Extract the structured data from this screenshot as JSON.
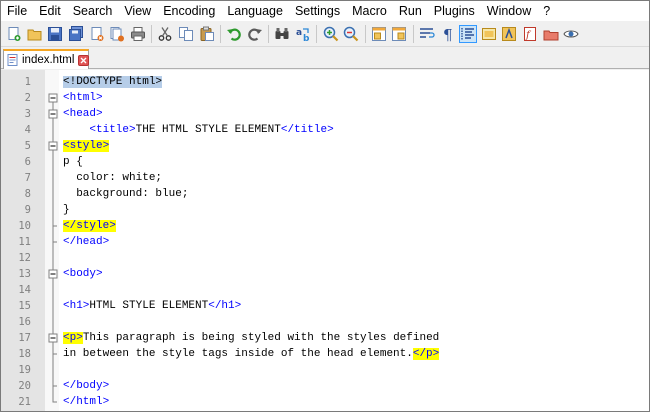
{
  "menu": [
    "File",
    "Edit",
    "Search",
    "View",
    "Encoding",
    "Language",
    "Settings",
    "Macro",
    "Run",
    "Plugins",
    "Window",
    "?"
  ],
  "toolbar": {
    "groups": [
      [
        "new-file-icon",
        "open-file-icon",
        "save-icon",
        "save-all-icon",
        "close-icon",
        "close-all-icon",
        "print-icon"
      ],
      [
        "cut-icon",
        "copy-icon",
        "paste-icon"
      ],
      [
        "undo-icon",
        "redo-icon"
      ],
      [
        "find-icon",
        "replace-icon"
      ],
      [
        "zoom-in-icon",
        "zoom-out-icon"
      ],
      [
        "sync-vertical-icon",
        "sync-horizontal-icon"
      ],
      [
        "word-wrap-icon",
        "show-all-chars-icon",
        "indent-guide-icon",
        "doc-map-icon",
        "function-list-icon",
        "folder-workspace-icon",
        "monitoring-icon"
      ]
    ],
    "active": "indent-guide-icon"
  },
  "tab": {
    "label": "index.html"
  },
  "lines": [
    {
      "n": "1",
      "segs": [
        [
          "doc",
          "<!DOCTYPE html>"
        ]
      ]
    },
    {
      "n": "2",
      "segs": [
        [
          "tag",
          "<html>"
        ]
      ]
    },
    {
      "n": "3",
      "segs": [
        [
          "tag",
          "<head>"
        ]
      ]
    },
    {
      "n": "4",
      "segs": [
        [
          "text",
          "    "
        ],
        [
          "tag",
          "<title>"
        ],
        [
          "text",
          "THE HTML STYLE ELEMENT"
        ],
        [
          "tag",
          "</title>"
        ]
      ]
    },
    {
      "n": "5",
      "segs": [
        [
          "hl-tag",
          "<style>"
        ]
      ]
    },
    {
      "n": "6",
      "segs": [
        [
          "text",
          "p {"
        ]
      ]
    },
    {
      "n": "7",
      "segs": [
        [
          "text",
          "  color: white;"
        ]
      ]
    },
    {
      "n": "8",
      "segs": [
        [
          "text",
          "  background: blue;"
        ]
      ]
    },
    {
      "n": "9",
      "segs": [
        [
          "text",
          "}"
        ]
      ]
    },
    {
      "n": "10",
      "segs": [
        [
          "hl-tag",
          "</style>"
        ]
      ]
    },
    {
      "n": "11",
      "segs": [
        [
          "tag",
          "</head>"
        ]
      ]
    },
    {
      "n": "12",
      "segs": []
    },
    {
      "n": "13",
      "segs": [
        [
          "tag",
          "<body>"
        ]
      ]
    },
    {
      "n": "14",
      "segs": []
    },
    {
      "n": "15",
      "segs": [
        [
          "tag",
          "<h1>"
        ],
        [
          "text",
          "HTML STYLE ELEMENT"
        ],
        [
          "tag",
          "</h1>"
        ]
      ]
    },
    {
      "n": "16",
      "segs": []
    },
    {
      "n": "17",
      "segs": [
        [
          "hl-tag",
          "<p>"
        ],
        [
          "text",
          "This paragraph is being styled with the styles defined"
        ]
      ]
    },
    {
      "n": "18",
      "segs": [
        [
          "text",
          "in between the style tags inside of the head element."
        ],
        [
          "hl-tag",
          "</p>"
        ]
      ]
    },
    {
      "n": "19",
      "segs": []
    },
    {
      "n": "20",
      "segs": [
        [
          "tag",
          "</body>"
        ]
      ]
    },
    {
      "n": "21",
      "segs": [
        [
          "tag",
          "</html>"
        ]
      ]
    }
  ],
  "folds": {
    "1": "none",
    "2": "box",
    "3": "box",
    "4": "line",
    "5": "box",
    "6": "line",
    "7": "line",
    "8": "line",
    "9": "line",
    "10": "end",
    "11": "end",
    "12": "line",
    "13": "box",
    "14": "line",
    "15": "line",
    "16": "line",
    "17": "box",
    "18": "end",
    "19": "line",
    "20": "end",
    "21": "end"
  },
  "colors": {
    "tag": "#0000ff",
    "highlight": "#ffff00",
    "doctype_bg": "#b6cde8",
    "tab_accent": "#f5a623"
  }
}
